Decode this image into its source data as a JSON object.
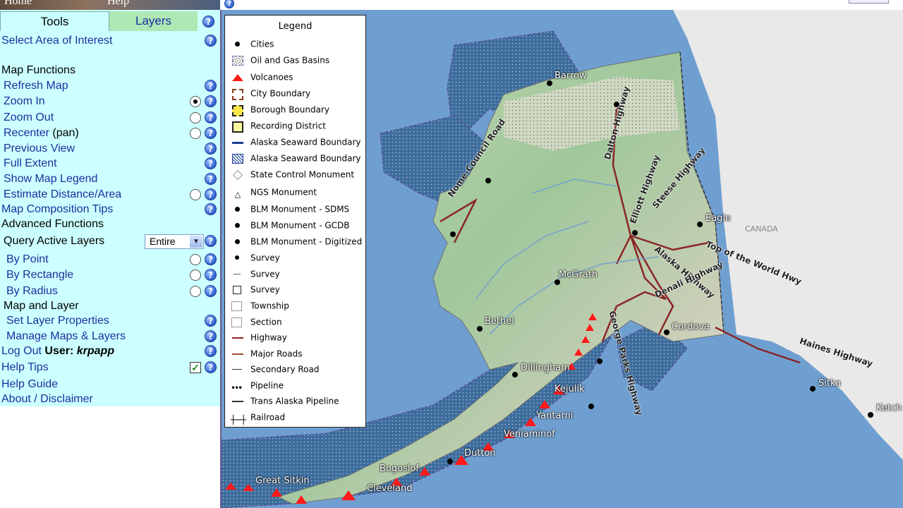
{
  "topbar": {
    "home": "Home",
    "help": "Help"
  },
  "tabs": {
    "tools": "Tools",
    "layers": "Layers"
  },
  "panel": {
    "select_area": "Select Area of Interest",
    "map_functions": "Map Functions",
    "refresh": "Refresh Map",
    "zoom_in": "Zoom In",
    "zoom_out": "Zoom Out",
    "recenter": "Recenter",
    "recenter_pan": "(pan)",
    "previous": "Previous View",
    "full_extent": "Full Extent",
    "show_legend": "Show Map Legend",
    "estimate": "Estimate Distance/Area",
    "composition": "Map Composition Tips",
    "advanced": "Advanced Functions",
    "query": "Query Active Layers",
    "query_select": "Entire",
    "by_point": "By Point",
    "by_rect": "By Rectangle",
    "by_radius": "By Radius",
    "map_layer": "Map and Layer",
    "set_layer": "Set Layer Properties",
    "manage": "Manage Maps & Layers",
    "logout": "Log Out",
    "user_label": "User:",
    "user_name": "krpapp",
    "help_tips": "Help Tips",
    "help_guide": "Help Guide",
    "about": "About / Disclaimer"
  },
  "legend": {
    "title": "Legend",
    "items": [
      "Cities",
      "Oil and Gas Basins",
      "Volcanoes",
      "City Boundary",
      "Borough Boundary",
      "Recording District",
      "Alaska Seaward Boundary",
      "Alaska Seaward Boundary",
      "State Control Monument",
      "NGS Monument",
      "BLM Monument - SDMS",
      "BLM Monument - GCDB",
      "BLM Monument - Digitized",
      "Survey",
      "Survey",
      "Survey",
      "Township",
      "Section",
      "Highway",
      "Major Roads",
      "Secondary Road",
      "Pipeline",
      "Trans Alaska Pipeline",
      "Railroad"
    ]
  },
  "map": {
    "cities": [
      "Barrow",
      "Eagle",
      "McGrath",
      "Bethel",
      "Cordova",
      "Dillingham",
      "Sitka",
      "Ketch"
    ],
    "volcanoes": [
      "Kejulik",
      "Yantarni",
      "Veniaminof",
      "Dutton",
      "Bogoslof",
      "Great Sitkin",
      "Cleveland"
    ],
    "roads": [
      "Nome-Council Road",
      "Dalton Highway",
      "Elliott Highway",
      "Steese Highway",
      "Alaska Highway",
      "Top of the World Hwy",
      "Denali Highway",
      "George Parks Highway",
      "Haines Highway"
    ],
    "country": "CANADA"
  }
}
